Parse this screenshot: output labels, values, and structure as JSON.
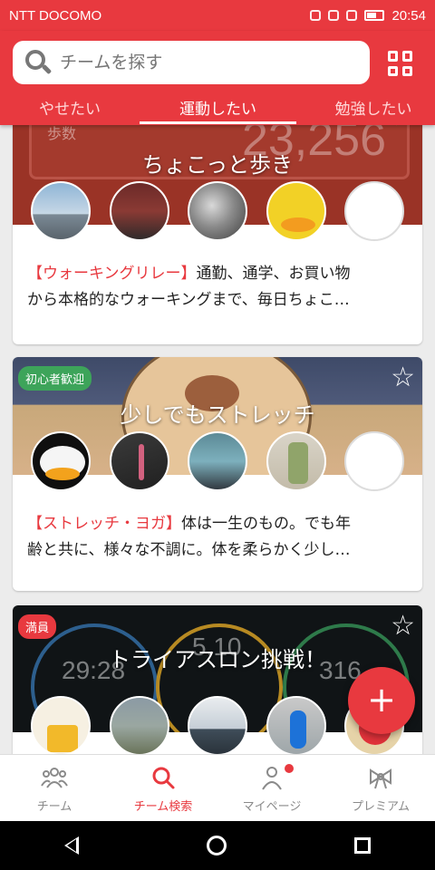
{
  "status_bar": {
    "carrier": "NTT DOCOMO",
    "time": "20:54"
  },
  "search": {
    "placeholder": "チームを探す"
  },
  "tabs": [
    {
      "label": "やせたい",
      "active": false
    },
    {
      "label": "運動したい",
      "active": true
    },
    {
      "label": "勉強したい",
      "active": false
    }
  ],
  "cards": [
    {
      "title": "ちょこっと歩き",
      "banner_lbl": "歩数",
      "banner_num": "23,256",
      "tag": "【ウォーキングリレー】",
      "line1": "通勤、通学、お買い物",
      "line2": "から本格的なウォーキングまで、毎日ちょこ…"
    },
    {
      "title": "少しでもストレッチ",
      "badge": "初心者歓迎",
      "tag": "【ストレッチ・ヨガ】",
      "line1": "体は一生のもの。でも年",
      "line2": "齢と共に、様々な不調に。体を柔らかく少し…"
    },
    {
      "title": "トライアスロン挑戦！",
      "badge": "満員",
      "num1": "29:28",
      "num2": "5.10",
      "num3": "316"
    }
  ],
  "fab": {
    "label": "+"
  },
  "bottom_nav": [
    {
      "label": "チーム",
      "icon": "team-icon",
      "active": false
    },
    {
      "label": "チーム検索",
      "icon": "search-icon",
      "active": true
    },
    {
      "label": "マイページ",
      "icon": "person-icon",
      "active": false
    },
    {
      "label": "プレミアム",
      "icon": "ribbon-icon",
      "active": false
    }
  ],
  "colors": {
    "accent": "#e8393f",
    "badge_green": "#3da45a"
  }
}
